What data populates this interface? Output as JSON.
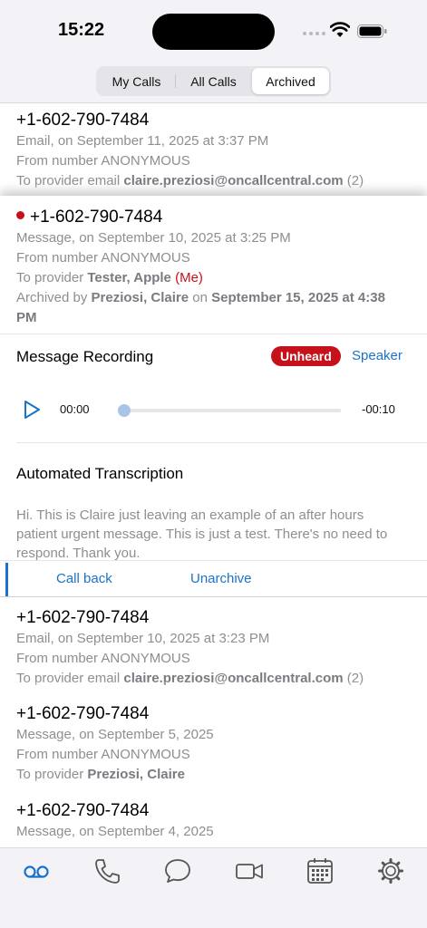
{
  "status_bar": {
    "time": "15:22"
  },
  "segments": [
    "My Calls",
    "All Calls",
    "Archived"
  ],
  "active_segment": "Archived",
  "items": [
    {
      "phone": "+1-602-790-7484",
      "detail": "Email, on September 11, 2025 at 3:37 PM",
      "from": "From number ANONYMOUS",
      "to_prefix": "To provider email ",
      "to_value": "claire.preziosi@oncallcentral.com",
      "to_suffix": " (2)"
    },
    {
      "phone": "+1-602-790-7484",
      "unread": true,
      "detail": "Message, on September 10, 2025 at 3:25 PM",
      "from": "From number ANONYMOUS",
      "to_prefix": "To provider ",
      "to_value": "Tester, Apple",
      "to_me": " (Me)",
      "archived_prefix": "Archived by ",
      "archived_by": "Preziosi, Claire",
      "archived_on_prefix": " on ",
      "archived_date": "September 15, 2025 at 4:38 PM",
      "recording_title": "Message Recording",
      "badge": "Unheard",
      "speaker": "Speaker",
      "time_start": "00:00",
      "time_end": "-00:10",
      "progress": 0.0,
      "transcription_title": "Automated Transcription",
      "transcription": "Hi. This is Claire just leaving an example of an after hours patient urgent message. This is just a test. There's no need to respond. Thank you.",
      "call_back": "Call back",
      "unarchive": "Unarchive"
    },
    {
      "phone": "+1-602-790-7484",
      "detail": "Email, on September 10, 2025 at 3:23 PM",
      "from": "From number ANONYMOUS",
      "to_prefix": "To provider email ",
      "to_value": "claire.preziosi@oncallcentral.com",
      "to_suffix": " (2)"
    },
    {
      "phone": "+1-602-790-7484",
      "detail": "Message, on September 5, 2025",
      "from": "From number ANONYMOUS",
      "to_prefix": "To provider ",
      "to_value": "Preziosi, Claire"
    },
    {
      "phone": "+1-602-790-7484",
      "detail": "Message, on September 4, 2025"
    }
  ],
  "tabs": [
    "voicemail-icon",
    "phone-icon",
    "chat-icon",
    "video-icon",
    "calendar-icon",
    "settings-icon"
  ],
  "colors": {
    "accent": "#1a73c9",
    "alert": "#c6111b"
  }
}
